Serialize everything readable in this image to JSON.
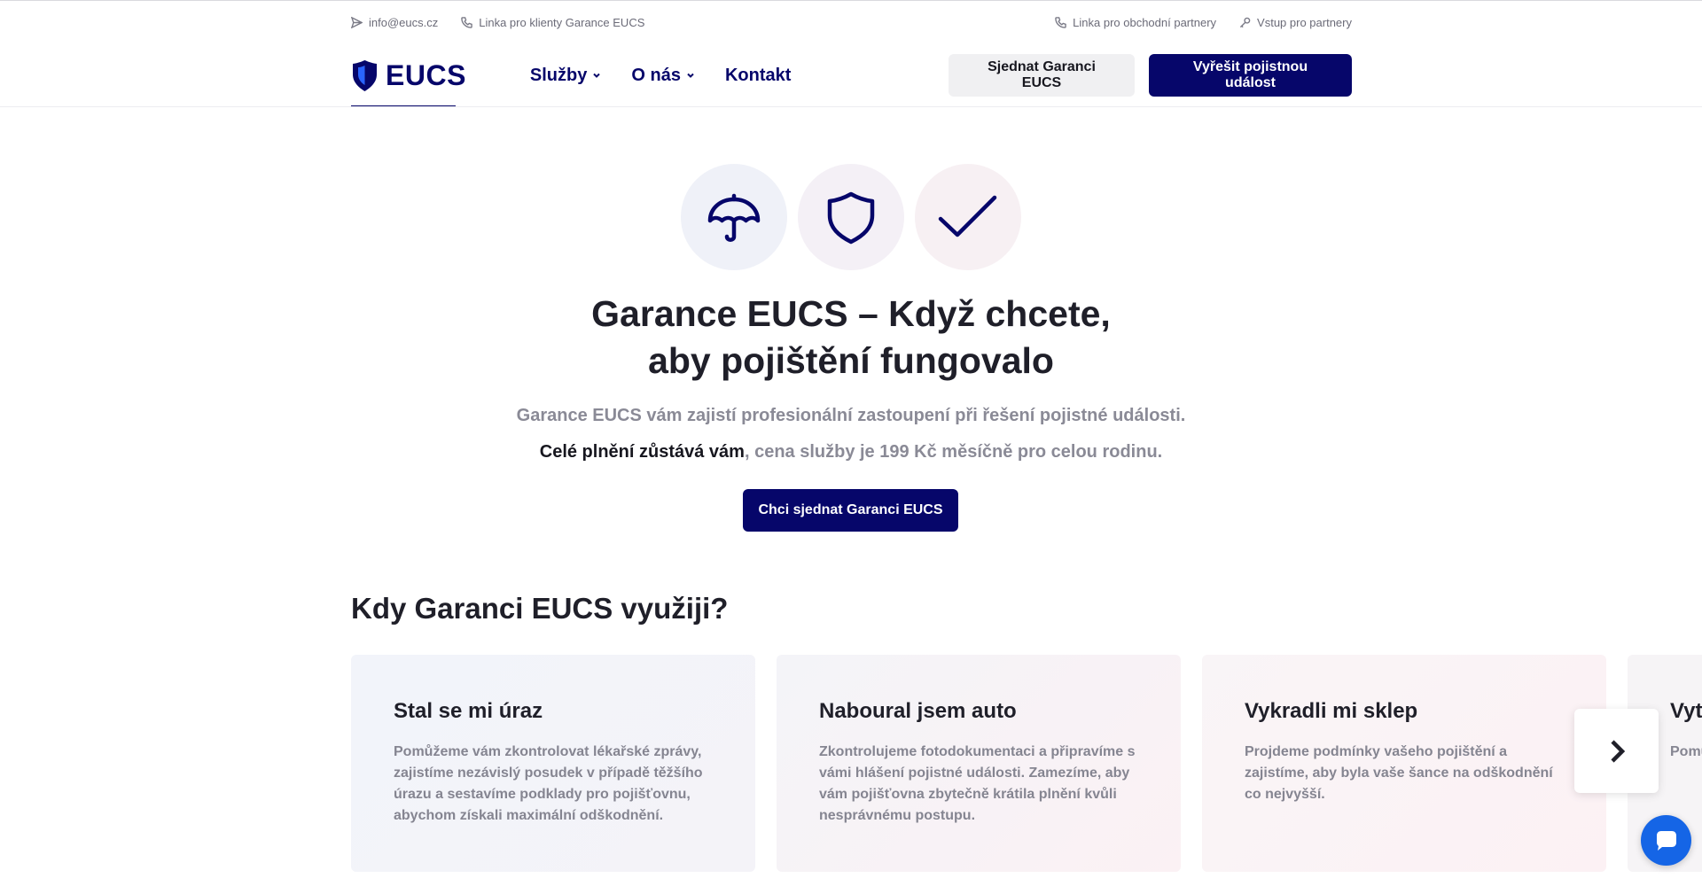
{
  "utility": {
    "email": "info@eucs.cz",
    "client_line": "Linka pro klienty Garance EUCS",
    "partner_line": "Linka pro obchodní partnery",
    "partner_login": "Vstup pro partnery"
  },
  "nav": {
    "logo": "EUCS",
    "menu": [
      "Služby",
      "O nás",
      "Kontakt"
    ],
    "btn_arrange": "Sjednat Garanci EUCS",
    "btn_solve": "Vyřešit pojistnou událost"
  },
  "hero": {
    "title_line1": "Garance EUCS – Když chcete,",
    "title_line2": "aby pojištění fungovalo",
    "sub1": "Garance EUCS vám zajistí profesionální zastoupení při řešení pojistné události.",
    "sub2_bold": "Celé plnění zůstává vám",
    "sub2_rest": ", cena služby je 199 Kč měsíčně pro celou rodinu.",
    "cta": "Chci sjednat Garanci EUCS",
    "icons": [
      "umbrella-icon",
      "shield-icon",
      "check-icon"
    ]
  },
  "section": {
    "title": "Kdy Garanci EUCS využiji?",
    "cards": [
      {
        "title": "Stal se mi úraz",
        "text": "Pomůžeme vám zkontrolovat lékařské zprávy, zajistíme nezávislý posudek v případě těžšího úrazu a sestavíme podklady pro pojišťovnu, abychom získali maximální odškodnění."
      },
      {
        "title": "Naboural jsem auto",
        "text": "Zkontrolujeme fotodokumentaci a připravíme s vámi hlášení pojistné události. Zamezíme, aby vám pojišťovna zbytečně krátila plnění kvůli nesprávnému postupu."
      },
      {
        "title": "Vykradli mi sklep",
        "text": "Projdeme podmínky vašeho pojištění a zajistíme, aby byla vaše šance na odškodnění co nejvyšší."
      },
      {
        "title": "Vyt",
        "text": "Pomů uplat a pro"
      }
    ]
  },
  "colors": {
    "brand": "#06066a",
    "chat": "#1565e6"
  }
}
